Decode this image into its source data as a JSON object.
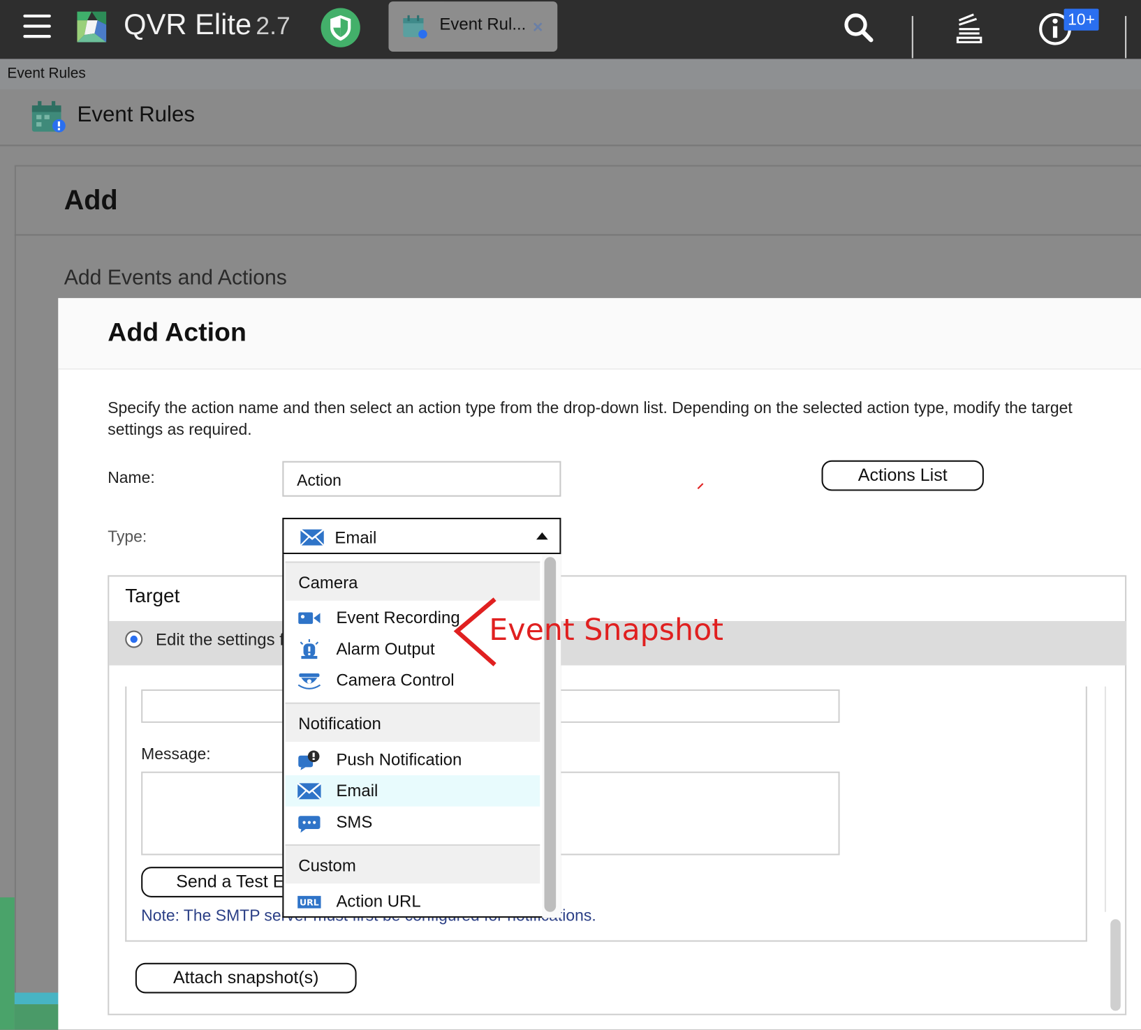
{
  "topbar": {
    "app_name": "QVR Elite",
    "app_version": "2.7",
    "tab_label": "Event Rul...",
    "tab_close": "×",
    "notification_badge": "10+",
    "icons": [
      "menu-icon",
      "qvr-logo-icon",
      "shield-icon",
      "event-rules-icon",
      "search-icon",
      "task-stack-icon",
      "info-icon"
    ]
  },
  "breadcrumb": "Event Rules",
  "page_title": "Event Rules",
  "add_panel": {
    "title": "Add",
    "subtitle": "Add Events and Actions"
  },
  "dialog": {
    "title": "Add Action",
    "description": "Specify the action name and then select an action type from the drop-down list. Depending on the selected action type, modify the target settings as required.",
    "name_label": "Name:",
    "name_value": "Action",
    "type_label": "Type:",
    "type_value": "Email",
    "actions_list_button": "Actions List",
    "target": {
      "title": "Target",
      "radio_label": "Edit the settings f",
      "message_label": "Message:",
      "send_test_button": "Send a Test E",
      "note": "Note: The SMTP server must first be configured for notifications.",
      "attach_button": "Attach snapshot(s)"
    }
  },
  "type_dropdown": {
    "groups": [
      {
        "label": "Camera",
        "items": [
          {
            "label": "Event Recording",
            "icon": "video-camera-icon"
          },
          {
            "label": "Alarm Output",
            "icon": "alarm-icon"
          },
          {
            "label": "Camera Control",
            "icon": "ptz-camera-icon"
          }
        ]
      },
      {
        "label": "Notification",
        "items": [
          {
            "label": "Push Notification",
            "icon": "push-notification-icon"
          },
          {
            "label": "Email",
            "icon": "email-icon",
            "selected": true
          },
          {
            "label": "SMS",
            "icon": "sms-icon"
          }
        ]
      },
      {
        "label": "Custom",
        "items": [
          {
            "label": "Action URL",
            "icon": "url-icon"
          }
        ]
      }
    ]
  },
  "annotation": {
    "text": "Event Snapshot",
    "color": "#e02020"
  },
  "colors": {
    "topbar": "#2e2e2e",
    "accent_blue": "#2a6ff0",
    "note_text": "#2b3f86",
    "selected_item": "#e8fbfd"
  }
}
